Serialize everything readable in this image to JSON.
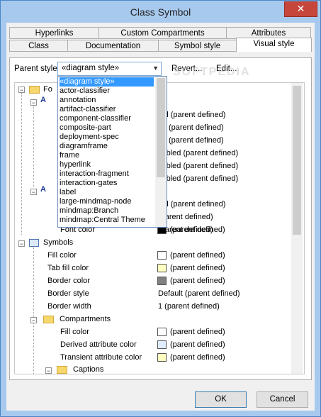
{
  "window": {
    "title": "Class Symbol",
    "close_glyph": "✕"
  },
  "tabs_top": [
    "Hyperlinks",
    "Custom Compartments",
    "Attributes"
  ],
  "tabs_bottom": [
    "Class",
    "Documentation",
    "Symbol style",
    "Visual style"
  ],
  "parent_style": {
    "label": "Parent style",
    "value": "«diagram style»",
    "revert": "Revert...",
    "edit": "Edit..."
  },
  "watermark": "SOFTPEDIA",
  "dropdown_items": [
    "«diagram style»",
    "actor-classifier",
    "annotation",
    "artifact-classifier",
    "component-classifier",
    "composite-part",
    "deployment-spec",
    "diagramframe",
    "frame",
    "hyperlink",
    "interaction-fragment",
    "interaction-gates",
    "label",
    "large-mindmap-node",
    "mindmap:Branch",
    "mindmap:Central Theme"
  ],
  "tree": {
    "fonts_label": "Fo",
    "hidden_values": [
      "rial  (parent defined)",
      "(parent defined)",
      "(parent defined)",
      "sabled  (parent defined)",
      "sabled  (parent defined)",
      "sabled  (parent defined)",
      "rial  (parent defined)",
      "(parent defined)",
      "(parent defined)"
    ],
    "font_color": {
      "label": "Font color",
      "value": "(parent defined)"
    },
    "symbols": "Symbols",
    "rows": [
      {
        "label": "Fill color",
        "value": "(parent defined)"
      },
      {
        "label": "Tab fill color",
        "value": "(parent defined)"
      },
      {
        "label": "Border color",
        "value": "(parent defined)"
      },
      {
        "label": "Border style",
        "value": "Default  (parent defined)"
      },
      {
        "label": "Border width",
        "value": "1  (parent defined)"
      }
    ],
    "compartments": "Compartments",
    "comp_rows": [
      {
        "label": "Fill color",
        "value": "(parent defined)"
      },
      {
        "label": "Derived attribute color",
        "value": "(parent defined)"
      },
      {
        "label": "Transient attribute color",
        "value": "(parent defined)"
      }
    ],
    "captions": "Captions"
  },
  "colors": {
    "white": "#ffffff",
    "yellow": "#ffffc0",
    "gray": "#808080",
    "black": "#000000",
    "lightblue": "#e0ecff"
  },
  "buttons": {
    "ok": "OK",
    "cancel": "Cancel"
  }
}
